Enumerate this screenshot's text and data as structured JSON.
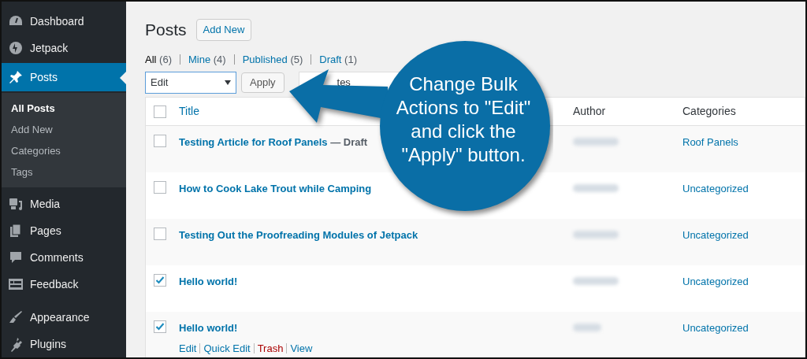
{
  "sidebar": {
    "items": [
      {
        "label": "Dashboard",
        "selected": false
      },
      {
        "label": "Jetpack",
        "selected": false
      },
      {
        "label": "Posts",
        "selected": true,
        "children": [
          {
            "label": "All Posts",
            "selected": true
          },
          {
            "label": "Add New",
            "selected": false
          },
          {
            "label": "Categories",
            "selected": false
          },
          {
            "label": "Tags",
            "selected": false
          }
        ]
      },
      {
        "label": "Media",
        "selected": false
      },
      {
        "label": "Pages",
        "selected": false
      },
      {
        "label": "Comments",
        "selected": false
      },
      {
        "label": "Feedback",
        "selected": false
      },
      {
        "label": "Appearance",
        "selected": false
      },
      {
        "label": "Plugins",
        "selected": false
      }
    ]
  },
  "page": {
    "title": "Posts",
    "add_new": "Add New"
  },
  "filters": [
    {
      "label": "All",
      "count": "(6)",
      "selected": true
    },
    {
      "label": "Mine",
      "count": "(4)",
      "selected": false
    },
    {
      "label": "Published",
      "count": "(5)",
      "selected": false
    },
    {
      "label": "Draft",
      "count": "(1)",
      "selected": false
    }
  ],
  "bulk_actions": {
    "value": "Edit",
    "apply": "Apply"
  },
  "date_filter": {
    "value": "tes"
  },
  "table": {
    "columns": [
      "Title",
      "Author",
      "Categories"
    ],
    "select_all_checked": false,
    "rows": [
      {
        "title": "Testing Article for Roof Panels",
        "state": "— Draft",
        "category": "Roof Panels",
        "checked": false
      },
      {
        "title": "How to Cook Lake Trout while Camping",
        "category": "Uncategorized",
        "checked": false
      },
      {
        "title": "Testing Out the Proofreading Modules of Jetpack",
        "category": "Uncategorized",
        "checked": false
      },
      {
        "title": "Hello world!",
        "category": "Uncategorized",
        "checked": true
      },
      {
        "title": "Hello world!",
        "category": "Uncategorized",
        "checked": true,
        "actions": [
          {
            "label": "Edit",
            "kind": "normal"
          },
          {
            "label": "Quick Edit",
            "kind": "normal"
          },
          {
            "label": "Trash",
            "kind": "danger"
          },
          {
            "label": "View",
            "kind": "normal"
          }
        ]
      }
    ]
  },
  "callout": {
    "text": "Change Bulk Actions to \"Edit\" and click the \"Apply\" button."
  }
}
